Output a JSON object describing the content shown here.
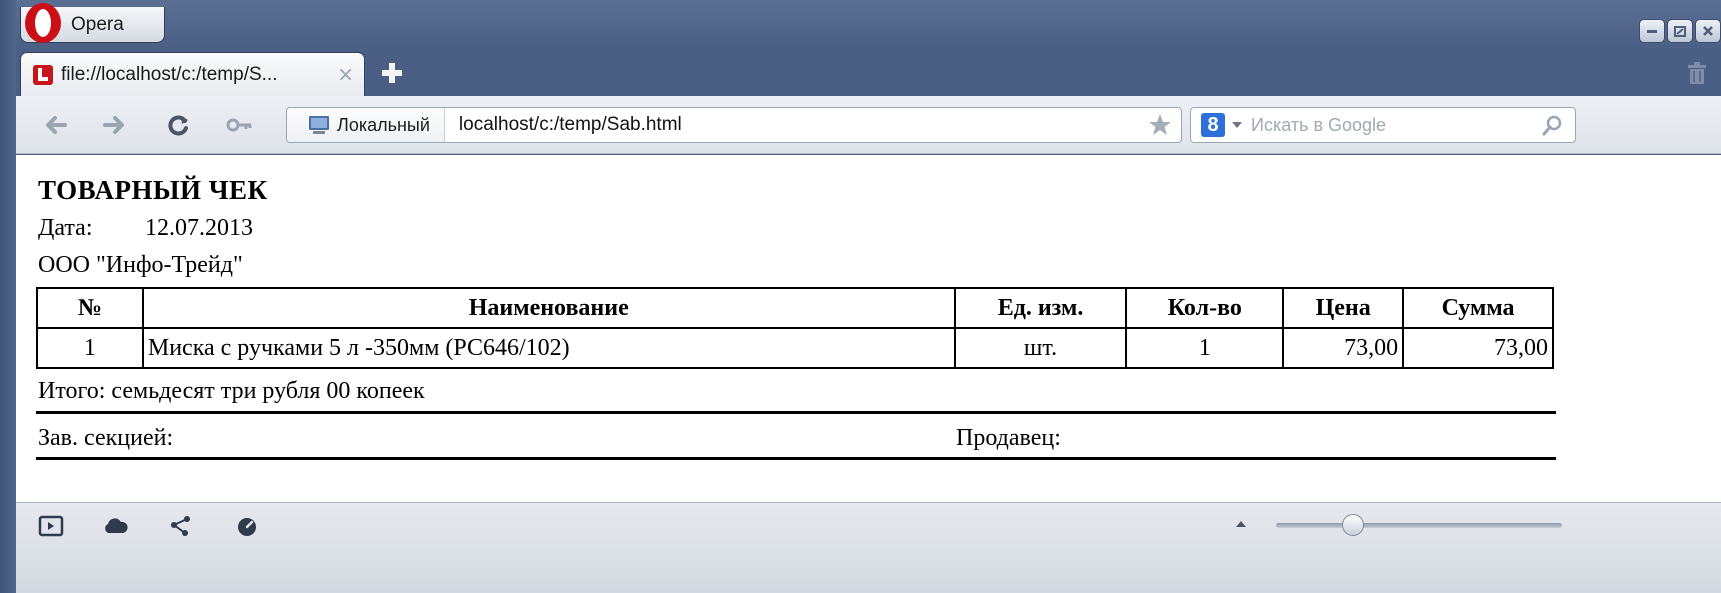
{
  "window": {
    "menu_label": "Opera",
    "icons": [
      "opera-logo-icon",
      "minimize-icon",
      "restore-icon",
      "close-icon"
    ]
  },
  "tabs": [
    {
      "title": "file://localhost/c:/temp/S...",
      "close": "×",
      "favicon": "local-file-icon"
    }
  ],
  "tabbar": {
    "new_tab": "plus-icon",
    "trash": "trash-icon"
  },
  "navigation": {
    "buttons": [
      "back-arrow-icon",
      "forward-arrow-icon",
      "reload-icon",
      "key-icon"
    ],
    "security_label": "Локальный",
    "url": "localhost/c:/temp/Sab.html",
    "search_placeholder": "Искать в Google",
    "search_engine": "8"
  },
  "document": {
    "title": "ТОВАРНЫЙ ЧЕК",
    "date_label": "Дата:",
    "date_value": "12.07.2013",
    "company": "ООО \"Инфо-Трейд\"",
    "table": {
      "headers": [
        "№",
        "Наименование",
        "Ед. изм.",
        "Кол-во",
        "Цена",
        "Сумма"
      ],
      "rows": [
        [
          "1",
          "Миска с ручками 5 л -350мм (РС646/102)",
          "шт.",
          "1",
          "73,00",
          "73,00"
        ]
      ]
    },
    "total": "Итого: семьдесят три рубля 00 копеек",
    "section_head": "Зав. секцией:",
    "seller": "Продавец:"
  },
  "statusbar": {
    "icons": [
      "panel-toggle-icon",
      "cloud-icon",
      "share-icon",
      "speed-dial-icon"
    ],
    "zoom_level": 0.27
  },
  "colors": {
    "frame": "#4a5f83",
    "toolbar": "#e4e8ee",
    "text": "#000000"
  }
}
